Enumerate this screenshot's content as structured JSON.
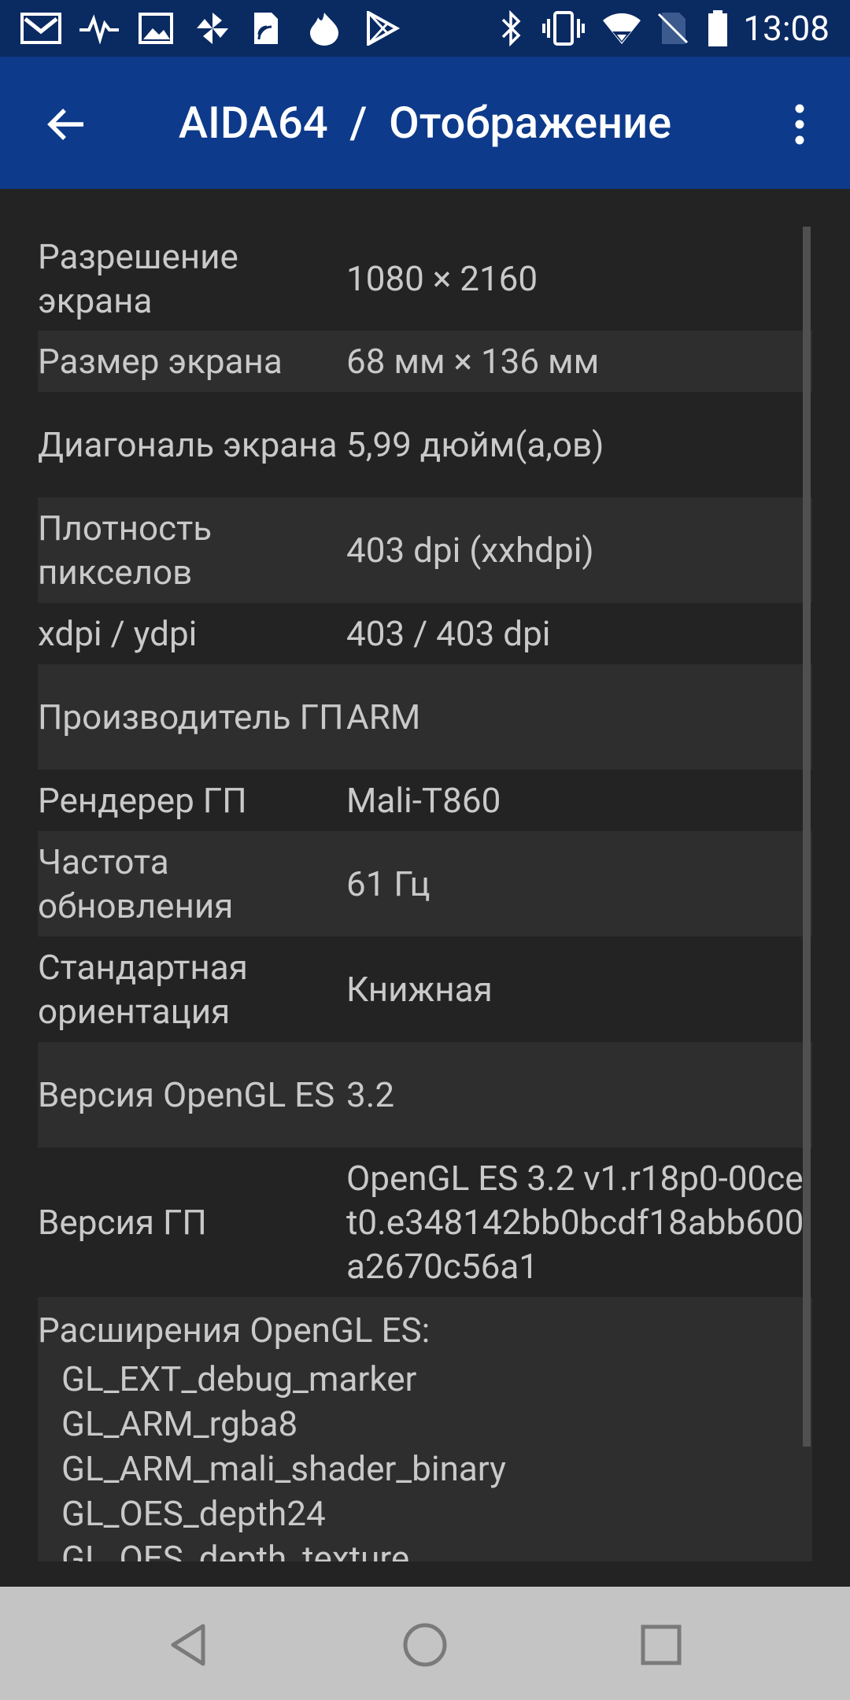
{
  "status_bar": {
    "time": "13:08",
    "icons_left": [
      "gmail-icon",
      "pulse-icon",
      "image-icon",
      "pinwheel-icon",
      "sim-card-icon",
      "fire-icon",
      "play-store-icon"
    ],
    "icons_right": [
      "bluetooth-icon",
      "vibrate-icon",
      "wifi-icon",
      "no-sim-icon",
      "battery-icon"
    ]
  },
  "app_bar": {
    "title": "AIDA64  /  Отображение"
  },
  "rows": [
    {
      "label": "Разрешение экрана",
      "value": "1080 × 2160"
    },
    {
      "label": "Размер экрана",
      "value": "68 мм × 136 мм"
    },
    {
      "label": "Диагональ экрана",
      "value": "5,99 дюйм(а,ов)"
    },
    {
      "label": "Плотность пикселов",
      "value": "403 dpi (xxhdpi)"
    },
    {
      "label": "xdpi / ydpi",
      "value": "403 / 403 dpi"
    },
    {
      "label": "Производитель ГП",
      "value": "ARM"
    },
    {
      "label": "Рендерер ГП",
      "value": "Mali-T860"
    },
    {
      "label": "Частота обновления",
      "value": "61 Гц"
    },
    {
      "label": "Стандартная ориентация",
      "value": "Книжная"
    },
    {
      "label": "Версия OpenGL ES",
      "value": "3.2"
    },
    {
      "label": "Версия ГП",
      "value": "OpenGL ES 3.2 v1.r18p0-00cet0.e348142bb0bcdf18abb600a2670c56a1"
    }
  ],
  "extensions": {
    "title": "Расширения OpenGL ES:",
    "items": [
      "GL_EXT_debug_marker",
      "GL_ARM_rgba8",
      "GL_ARM_mali_shader_binary",
      "GL_OES_depth24",
      "GL_OES_depth_texture"
    ]
  },
  "colors": {
    "status_bar": "#0a2a62",
    "app_bar": "#0d3a8a",
    "background": "#232323",
    "row_alt": "#2e2e2e",
    "nav_bar": "#c4c4c4"
  }
}
